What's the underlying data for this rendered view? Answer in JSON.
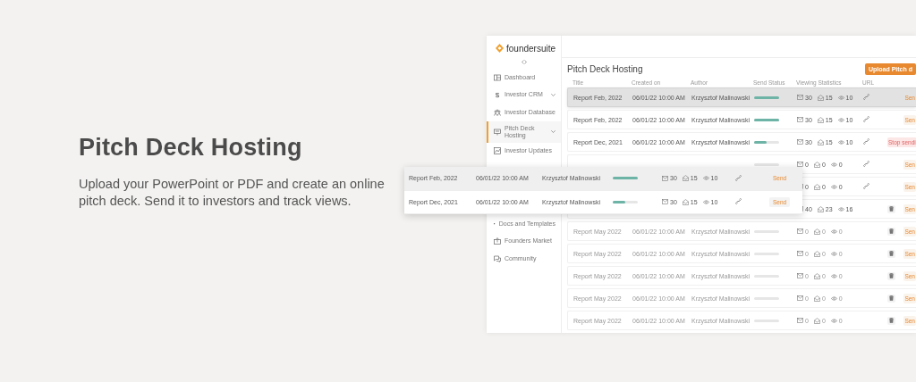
{
  "hero": {
    "title": "Pitch Deck Hosting",
    "text": "Upload your PowerPoint or PDF and create an online pitch deck. Send it to investors and track views."
  },
  "app": {
    "logo": "foundersuite",
    "sidebar": [
      {
        "label": "Dashboard",
        "selected": false,
        "expandable": false,
        "after_gap": false
      },
      {
        "label": "Investor CRM",
        "glyph": "$",
        "selected": false,
        "expandable": true,
        "after_gap": false
      },
      {
        "label": "Investor Database",
        "selected": false,
        "expandable": false,
        "after_gap": false
      },
      {
        "label": "Pitch Deck Hosting",
        "selected": true,
        "expandable": true,
        "after_gap": false
      },
      {
        "label": "Investor Updates",
        "selected": false,
        "expandable": false,
        "after_gap": false
      },
      {
        "label": "Docs and Templates",
        "selected": false,
        "expandable": false,
        "after_gap": true
      },
      {
        "label": "Founders Market",
        "selected": false,
        "expandable": false,
        "after_gap": false
      },
      {
        "label": "Community",
        "selected": false,
        "expandable": false,
        "after_gap": false
      }
    ],
    "page_title": "Pitch Deck Hosting",
    "upload_button": "Upload Pitch d",
    "columns": [
      "Title",
      "Created on",
      "Author",
      "Send Status",
      "Viewing Statistics",
      "URL"
    ],
    "rows": [
      {
        "title": "Report Feb, 2022",
        "created": "06/01/22 10:00 AM",
        "author": "Krzysztof Malinowski",
        "level": 1,
        "sent": "30",
        "opened": "15",
        "viewed": "10",
        "link": true,
        "deletable": false,
        "action": {
          "kind": "send",
          "label": "Sen"
        },
        "selected": true,
        "muted": false
      },
      {
        "title": "Report Feb, 2022",
        "created": "06/01/22 10:00 AM",
        "author": "Krzysztof Malinowski",
        "level": 1,
        "sent": "30",
        "opened": "15",
        "viewed": "10",
        "link": true,
        "deletable": false,
        "action": {
          "kind": "send",
          "label": "Sen"
        },
        "selected": false,
        "muted": false
      },
      {
        "title": "Report Dec, 2021",
        "created": "06/01/22 10:00 AM",
        "author": "Krzysztof Malinowski",
        "level": 0.5,
        "sent": "30",
        "opened": "15",
        "viewed": "10",
        "link": true,
        "deletable": false,
        "action": {
          "kind": "stop",
          "label": "Stop sendi"
        },
        "selected": false,
        "muted": false
      },
      {
        "level": 0,
        "sent": "0",
        "opened": "0",
        "viewed": "0",
        "link": true,
        "deletable": false,
        "action": {
          "kind": "send",
          "label": "Sen"
        },
        "selected": false,
        "muted": false
      },
      {
        "sent": "0",
        "opened": "0",
        "viewed": "0",
        "link": true,
        "deletable": false,
        "action": {
          "kind": "send",
          "label": "Sen"
        },
        "selected": false,
        "muted": false
      },
      {
        "sent": "40",
        "opened": "23",
        "viewed": "16",
        "link": false,
        "deletable": true,
        "action": {
          "kind": "send",
          "label": "Sen"
        },
        "selected": false,
        "muted": false
      },
      {
        "title": "Report May 2022",
        "created": "06/01/22 10:00 AM",
        "author": "Krzysztof Malinowski",
        "level": 0,
        "sent": "0",
        "opened": "0",
        "viewed": "0",
        "link": false,
        "deletable": true,
        "action": {
          "kind": "send",
          "label": "Sen"
        },
        "selected": false,
        "muted": true
      },
      {
        "title": "Report May 2022",
        "created": "06/01/22 10:00 AM",
        "author": "Krzysztof Malinowski",
        "level": 0,
        "sent": "0",
        "opened": "0",
        "viewed": "0",
        "link": false,
        "deletable": true,
        "action": {
          "kind": "send",
          "label": "Sen"
        },
        "selected": false,
        "muted": true
      },
      {
        "title": "Report May 2022",
        "created": "06/01/22 10:00 AM",
        "author": "Krzysztof Malinowski",
        "level": 0,
        "sent": "0",
        "opened": "0",
        "viewed": "0",
        "link": false,
        "deletable": true,
        "action": {
          "kind": "send",
          "label": "Sen"
        },
        "selected": false,
        "muted": true
      },
      {
        "title": "Report May 2022",
        "created": "06/01/22 10:00 AM",
        "author": "Krzysztof Malinowski",
        "level": 0,
        "sent": "0",
        "opened": "0",
        "viewed": "0",
        "link": false,
        "deletable": true,
        "action": {
          "kind": "send",
          "label": "Sen"
        },
        "selected": false,
        "muted": true
      },
      {
        "title": "Report May 2022",
        "created": "06/01/22 10:00 AM",
        "author": "Krzysztof Malinowski",
        "level": 0,
        "sent": "0",
        "opened": "0",
        "viewed": "0",
        "link": false,
        "deletable": true,
        "action": {
          "kind": "send",
          "label": "Sen"
        },
        "selected": false,
        "muted": true
      }
    ],
    "popup_rows": [
      {
        "title": "Report Feb, 2022",
        "created": "06/01/22 10:00 AM",
        "author": "Krzysztof Malinowski",
        "level": 1,
        "sent": "30",
        "opened": "15",
        "viewed": "10",
        "action": "Send",
        "selected": true
      },
      {
        "title": "Report Dec, 2021",
        "created": "06/01/22 10:00 AM",
        "author": "Krzysztof Malinowski",
        "level": 0.5,
        "sent": "30",
        "opened": "15",
        "viewed": "10",
        "action": "Send",
        "selected": false
      }
    ]
  }
}
